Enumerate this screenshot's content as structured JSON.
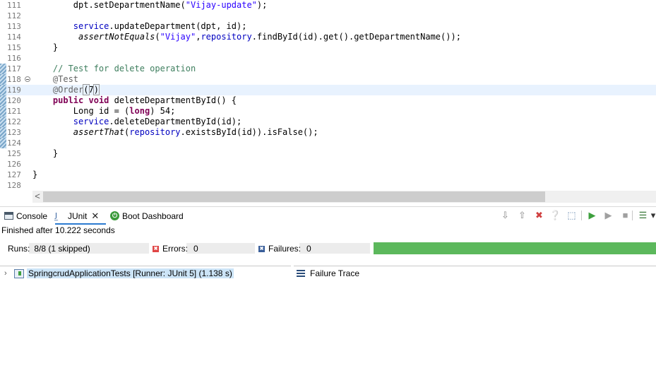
{
  "editor": {
    "lines": [
      {
        "num": "111",
        "segments": [
          {
            "t": "        "
          },
          {
            "t": "dpt",
            "c": "plain"
          },
          {
            "t": ".setDepartmentName("
          },
          {
            "t": "\"Vijay-update\"",
            "c": "str"
          },
          {
            "t": ");"
          }
        ]
      },
      {
        "num": "112",
        "segments": []
      },
      {
        "num": "113",
        "segments": [
          {
            "t": "        "
          },
          {
            "t": "service",
            "c": "fld"
          },
          {
            "t": ".updateDepartment(dpt, id);"
          }
        ]
      },
      {
        "num": "114",
        "segments": [
          {
            "t": "         "
          },
          {
            "t": "assertNotEquals",
            "c": "st"
          },
          {
            "t": "("
          },
          {
            "t": "\"Vijay\"",
            "c": "str"
          },
          {
            "t": ","
          },
          {
            "t": "repository",
            "c": "fld"
          },
          {
            "t": ".findById(id).get().getDepartmentName());"
          }
        ]
      },
      {
        "num": "115",
        "segments": [
          {
            "t": "    }"
          }
        ]
      },
      {
        "num": "116",
        "segments": []
      },
      {
        "num": "117",
        "segments": [
          {
            "t": "    "
          },
          {
            "t": "// Test for delete operation",
            "c": "cm"
          }
        ]
      },
      {
        "num": "118",
        "fold": true,
        "segments": [
          {
            "t": "    "
          },
          {
            "t": "@Test",
            "c": "ann"
          }
        ]
      },
      {
        "num": "119",
        "current": true,
        "segments": [
          {
            "t": "    "
          },
          {
            "t": "@Order",
            "c": "ann"
          },
          {
            "t": "(",
            "c": "brk"
          },
          {
            "t": "7"
          },
          {
            "t": ")",
            "c": "brk"
          }
        ]
      },
      {
        "num": "120",
        "segments": [
          {
            "t": "    "
          },
          {
            "t": "public",
            "c": "kw"
          },
          {
            "t": " "
          },
          {
            "t": "void",
            "c": "kw"
          },
          {
            "t": " deleteDepartmentById() {"
          }
        ]
      },
      {
        "num": "121",
        "segments": [
          {
            "t": "        Long id = ("
          },
          {
            "t": "long",
            "c": "kw"
          },
          {
            "t": ") 54;"
          }
        ]
      },
      {
        "num": "122",
        "segments": [
          {
            "t": "        "
          },
          {
            "t": "service",
            "c": "fld"
          },
          {
            "t": ".deleteDepartmentById(id);"
          }
        ]
      },
      {
        "num": "123",
        "segments": [
          {
            "t": "        "
          },
          {
            "t": "assertThat",
            "c": "st"
          },
          {
            "t": "("
          },
          {
            "t": "repository",
            "c": "fld"
          },
          {
            "t": ".existsById(id)).isFalse();"
          }
        ]
      },
      {
        "num": "124",
        "segments": []
      },
      {
        "num": "125",
        "segments": [
          {
            "t": "    }"
          }
        ]
      },
      {
        "num": "126",
        "segments": []
      },
      {
        "num": "127",
        "segments": [
          {
            "t": "}"
          }
        ]
      },
      {
        "num": "128",
        "segments": []
      }
    ]
  },
  "scrollbar": {
    "left_arrow": "<"
  },
  "view_tabs": {
    "console": "Console",
    "junit": "JUnit",
    "junit_icon": "J̲",
    "junit_close": "✕",
    "boot": "Boot Dashboard",
    "boot_icon": "⏻"
  },
  "toolbar_icons": [
    {
      "name": "next-failure-icon",
      "glyph": "⇩",
      "color": "#8a8a8a"
    },
    {
      "name": "previous-failure-icon",
      "glyph": "⇧",
      "color": "#8a8a8a"
    },
    {
      "name": "show-failures-only-icon",
      "glyph": "✖",
      "color": "#d04040"
    },
    {
      "name": "show-skipped-icon",
      "glyph": "❔",
      "color": "#5b7fa8"
    },
    {
      "name": "scroll-lock-icon",
      "glyph": "⬚",
      "color": "#5b7fa8"
    },
    {
      "name": "rerun-test-icon",
      "glyph": "▶",
      "color": "#3ea03e"
    },
    {
      "name": "rerun-failures-icon",
      "glyph": "▶",
      "color": "#a0a0a0"
    },
    {
      "name": "stop-icon",
      "glyph": "■",
      "color": "#a0a0a0"
    },
    {
      "name": "test-history-icon",
      "glyph": "☰",
      "color": "#3a7a3a"
    },
    {
      "name": "view-menu-icon",
      "glyph": "▾",
      "color": "#333333"
    }
  ],
  "junit": {
    "finished": "Finished after 10.222 seconds",
    "runs_label": "Runs:",
    "runs_value": "8/8 (1 skipped)",
    "errors_label": "Errors:",
    "errors_value": "0",
    "failures_label": "Failures:",
    "failures_value": "0",
    "error_icon": "✖",
    "failure_icon": "✖",
    "progress": 1.0,
    "progress_color": "#5cb85c",
    "tree": {
      "chevron": "›",
      "label": "SpringcrudApplicationTests [Runner: JUnit 5] (1.138 s)"
    },
    "failure_trace": "Failure Trace"
  }
}
